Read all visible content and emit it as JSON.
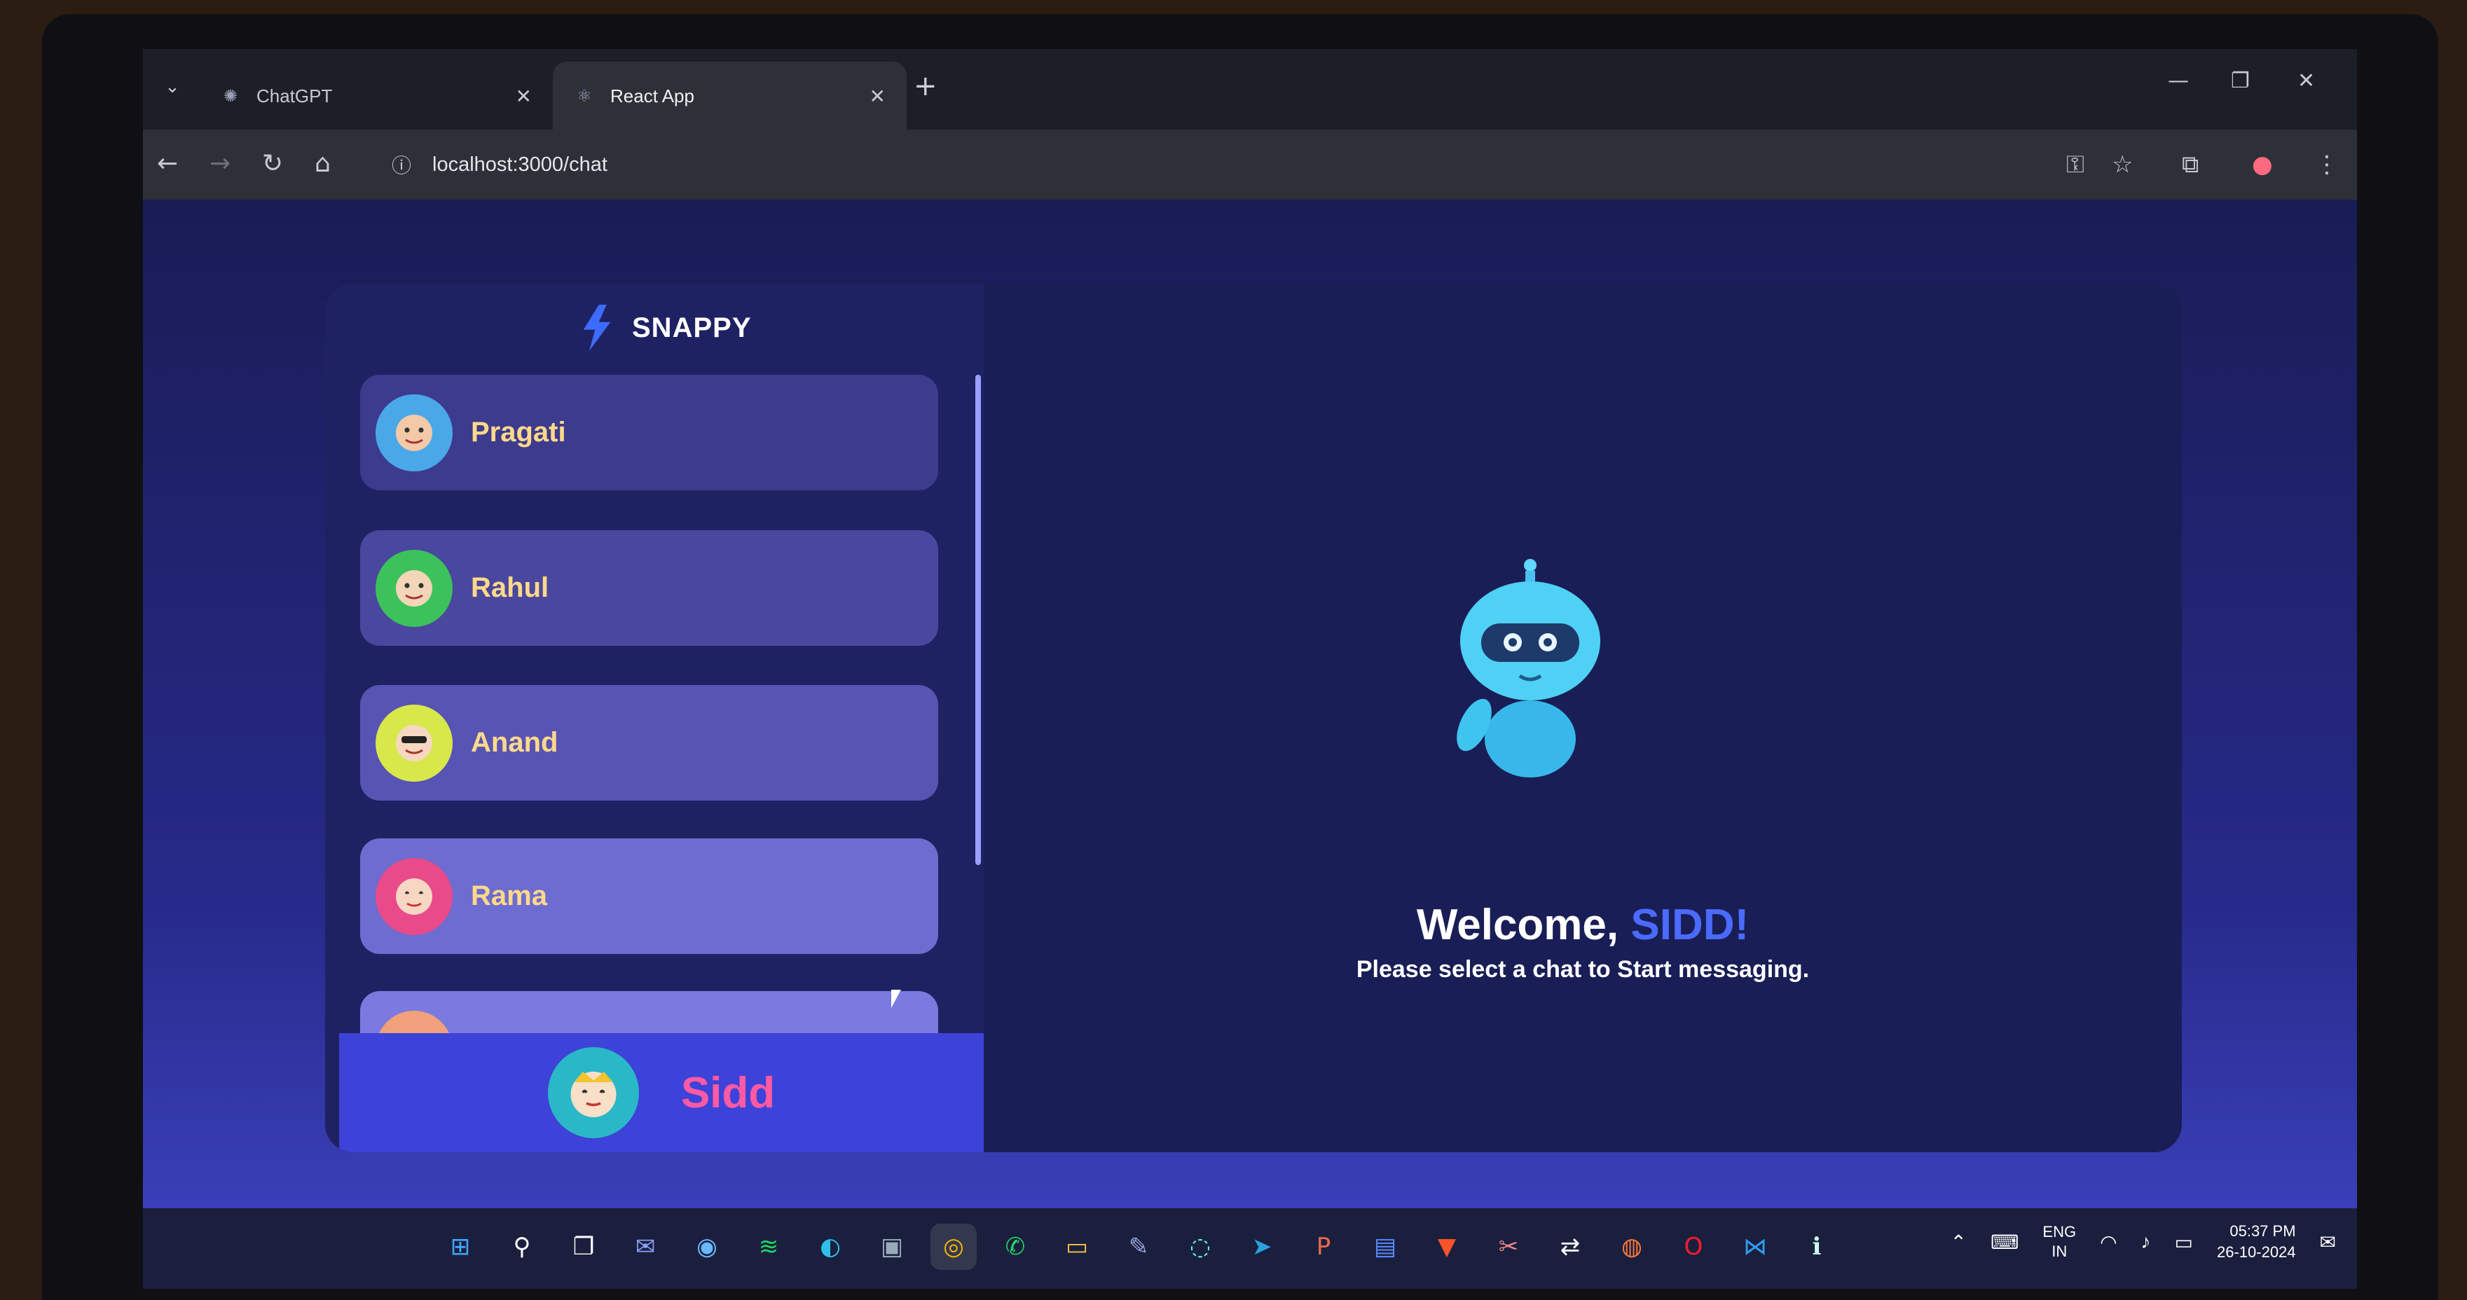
{
  "browser": {
    "tabs": [
      {
        "label": "ChatGPT",
        "icon": "chatgpt-icon",
        "active": false
      },
      {
        "label": "React App",
        "icon": "react-icon",
        "active": true
      }
    ],
    "url": "localhost:3000/chat"
  },
  "app": {
    "brand": "SNAPPY",
    "contacts": [
      {
        "name": "Pragati",
        "avatar_color": "#4aa8e8",
        "card_color": "#3d3b8e"
      },
      {
        "name": "Rahul",
        "avatar_color": "#3cc25a",
        "card_color": "#4a479e"
      },
      {
        "name": "Anand",
        "avatar_color": "#d8e84a",
        "card_color": "#5854b4"
      },
      {
        "name": "Rama",
        "avatar_color": "#e84a8a",
        "card_color": "#6d6cd0"
      },
      {
        "name": "",
        "avatar_color": "#f0a07a",
        "card_color": "#7a7ae0"
      }
    ],
    "current_user": {
      "name": "Sidd"
    },
    "welcome": {
      "prefix": "Welcome, ",
      "name": "SIDD!",
      "subtitle": "Please select a chat to Start messaging."
    }
  },
  "system_tray": {
    "lang_top": "ENG",
    "lang_bottom": "IN",
    "time": "05:37 PM",
    "date": "26-10-2024"
  },
  "taskbar_apps": [
    "start-icon",
    "search-icon",
    "task-view-icon",
    "chat-icon",
    "browser-icon",
    "spotify-icon",
    "edge-icon",
    "store-icon",
    "chrome-icon",
    "whatsapp-icon",
    "files-icon",
    "notes-icon",
    "loader-icon",
    "telegram-icon",
    "powerpoint-icon",
    "app-icon",
    "brave-icon",
    "snip-icon",
    "sync-icon",
    "firefox-icon",
    "opera-icon",
    "vscode-icon",
    "info-icon"
  ]
}
